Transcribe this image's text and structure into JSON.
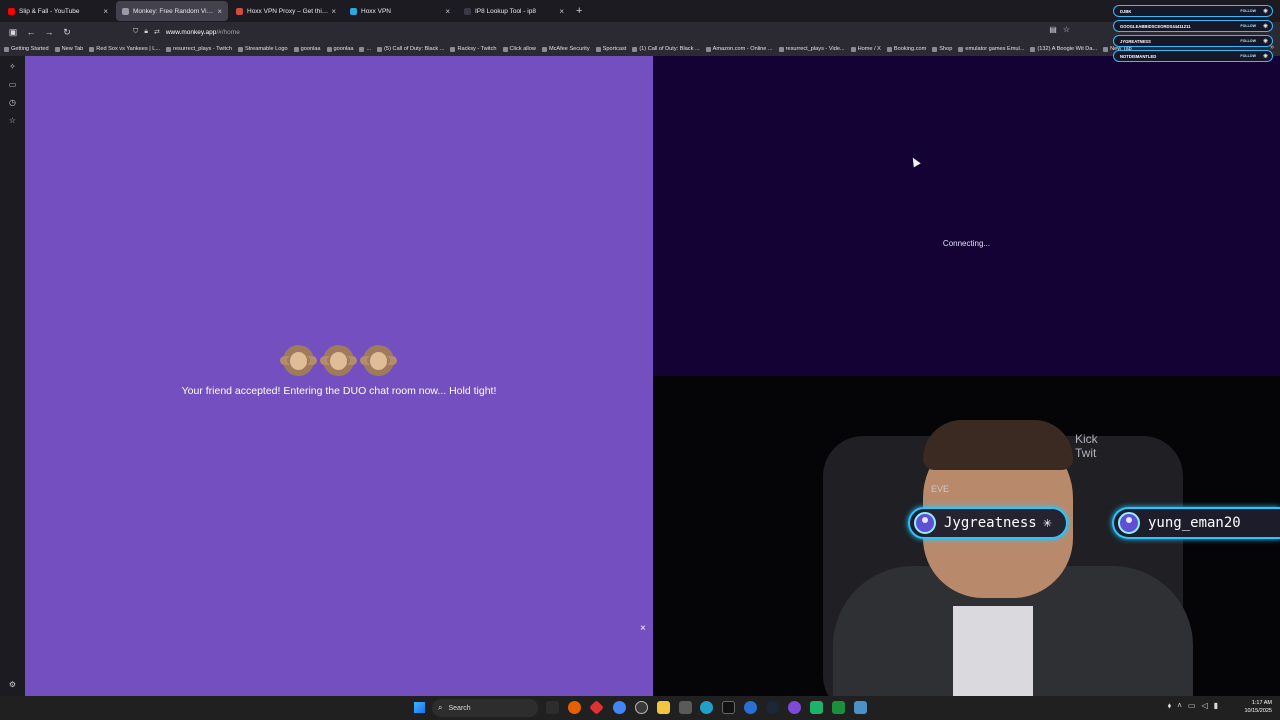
{
  "tabs": [
    {
      "title": "Slip & Fall - YouTube",
      "color": "#ff0000",
      "active": false
    },
    {
      "title": "Monkey: Free Random Video C",
      "color": "#9c9aa6",
      "active": true
    },
    {
      "title": "Hoxx VPN Proxy – Get this Exte",
      "color": "#d24b3e",
      "active": false
    },
    {
      "title": "Hoxx VPN",
      "color": "#2aa9e0",
      "active": false
    },
    {
      "title": "IP8 Lookup Tool - ip8",
      "color": "#3a3a45",
      "active": false
    }
  ],
  "tab_close_glyph": "×",
  "new_tab_glyph": "+",
  "nav": {
    "back_icon": "←",
    "forward_icon": "→",
    "reload_icon": "↻",
    "url_host": "www.monkey.app",
    "url_path": "/#/home"
  },
  "bookmarks": [
    "Getting Started",
    "New Tab",
    "Red Sox vs Yankees | L...",
    "resurrect_plays - Twitch",
    "Streamable Logo",
    "goonlaa",
    "goonlaa",
    "...",
    "(5) Call of Duty: Black ...",
    "Racksy - Twitch",
    "Click allow",
    "McAfee Security",
    "Sportcast",
    "(1) Call of Duty: Black ...",
    "Amazon.com - Online ...",
    "resurrect_plays - Vide...",
    "Home / X",
    "Booking.com",
    "Shop",
    "emulator games Emul...",
    "(132) A Boogie Wit Da...",
    "New Tab"
  ],
  "bookmarks_more": "»",
  "left_panel": {
    "bg": "#744fbf",
    "message": "Your friend accepted! Entering the DUO chat room now... Hold tight!",
    "close_glyph": "×"
  },
  "right_panel": {
    "bg": "#150235",
    "status": "Connecting..."
  },
  "webcam": {
    "bg_text_1": "Kick",
    "bg_text_2": "Twit",
    "bg_text_3": "EVE",
    "badge_left": "Jygreatness",
    "badge_right": "yung_eman20",
    "badge_spark": "✳"
  },
  "stream_overlay": [
    {
      "name": "DJBK",
      "follow": "FOLLOW"
    },
    {
      "name": "GOOGLEABBIDSCEORDS44411211",
      "follow": "FOLLOW"
    },
    {
      "name": "JYGREATNESS",
      "follow": "FOLLOW"
    },
    {
      "name": "NOTDISMANTLED",
      "follow": "FOLLOW"
    }
  ],
  "taskbar": {
    "search_label": "Search",
    "time": "1:17 AM",
    "date": "10/15/2025"
  }
}
